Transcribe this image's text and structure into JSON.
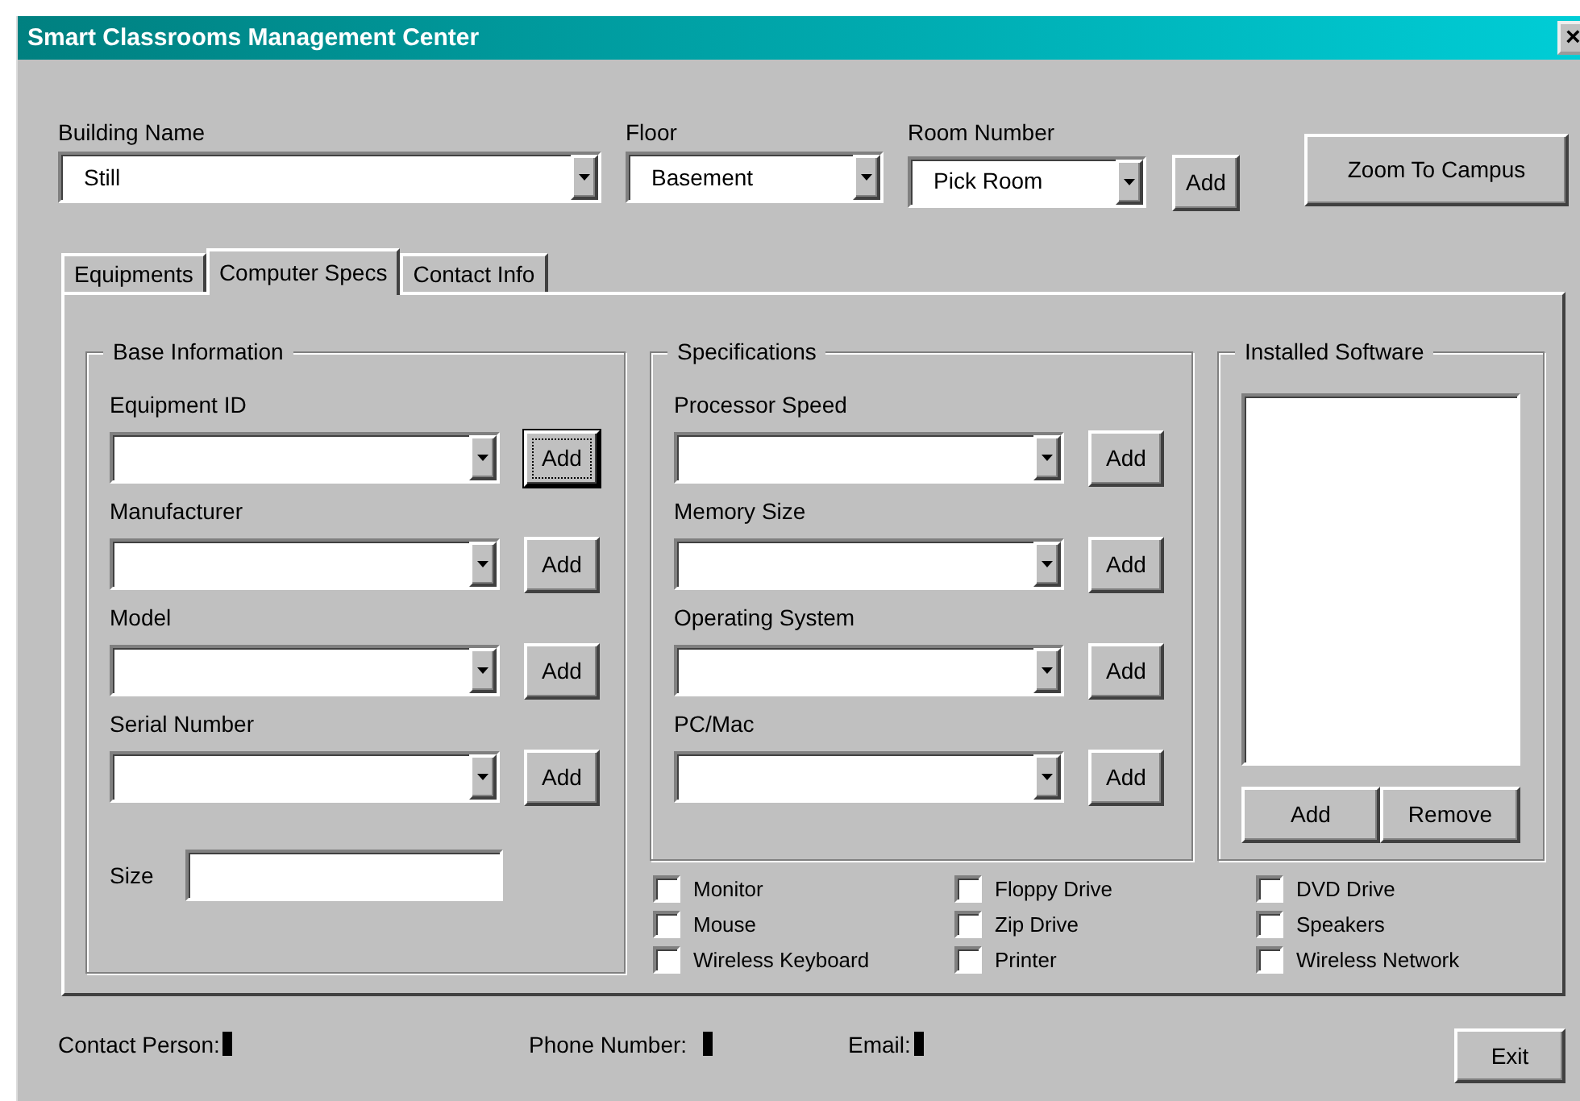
{
  "window": {
    "title": "Smart Classrooms Management Center",
    "close_button": "×"
  },
  "location": {
    "fields": [
      {
        "label": "Building Name",
        "value": "Still"
      },
      {
        "label": "Floor",
        "value": "Basement"
      },
      {
        "label": "Room Number",
        "value": "Pick Room"
      }
    ],
    "add_button": "Add",
    "zoom_button": "Zoom To Campus"
  },
  "tabs": [
    {
      "label": "Equipments",
      "selected": false
    },
    {
      "label": "Computer Specs",
      "selected": true
    },
    {
      "label": "Contact Info",
      "selected": false
    }
  ],
  "base_information": {
    "title": "Base Information",
    "fields": [
      {
        "label": "Equipment ID",
        "button": "Add",
        "focused": true
      },
      {
        "label": "Manufacturer",
        "button": "Add",
        "focused": false
      },
      {
        "label": "Model",
        "button": "Add",
        "focused": false
      },
      {
        "label": "Serial Number",
        "button": "Add",
        "focused": false
      }
    ],
    "size": {
      "label": "Size"
    }
  },
  "specifications": {
    "title": "Specifications",
    "fields": [
      {
        "label": "Processor Speed",
        "button": "Add",
        "focused": false
      },
      {
        "label": "Memory Size",
        "button": "Add",
        "focused": false
      },
      {
        "label": "Operating System",
        "button": "Add",
        "focused": false
      },
      {
        "label": "PC/Mac",
        "button": "Add",
        "focused": false
      }
    ]
  },
  "installed_software": {
    "title": "Installed Software",
    "buttons": [
      "Add",
      "Remove"
    ]
  },
  "peripherals": [
    {
      "label": "Monitor",
      "checked": false
    },
    {
      "label": "Floppy Drive",
      "checked": false
    },
    {
      "label": "DVD Drive",
      "checked": false
    },
    {
      "label": "Mouse",
      "checked": false
    },
    {
      "label": "Zip Drive",
      "checked": false
    },
    {
      "label": "Speakers",
      "checked": false
    },
    {
      "label": "Wireless Keyboard",
      "checked": false
    },
    {
      "label": "Printer",
      "checked": false
    },
    {
      "label": "Wireless Network",
      "checked": false
    }
  ],
  "contacts": [
    {
      "label": "Contact Person:"
    },
    {
      "label": "Phone Number:"
    },
    {
      "label": "Email:"
    }
  ],
  "exit_button": "Exit"
}
